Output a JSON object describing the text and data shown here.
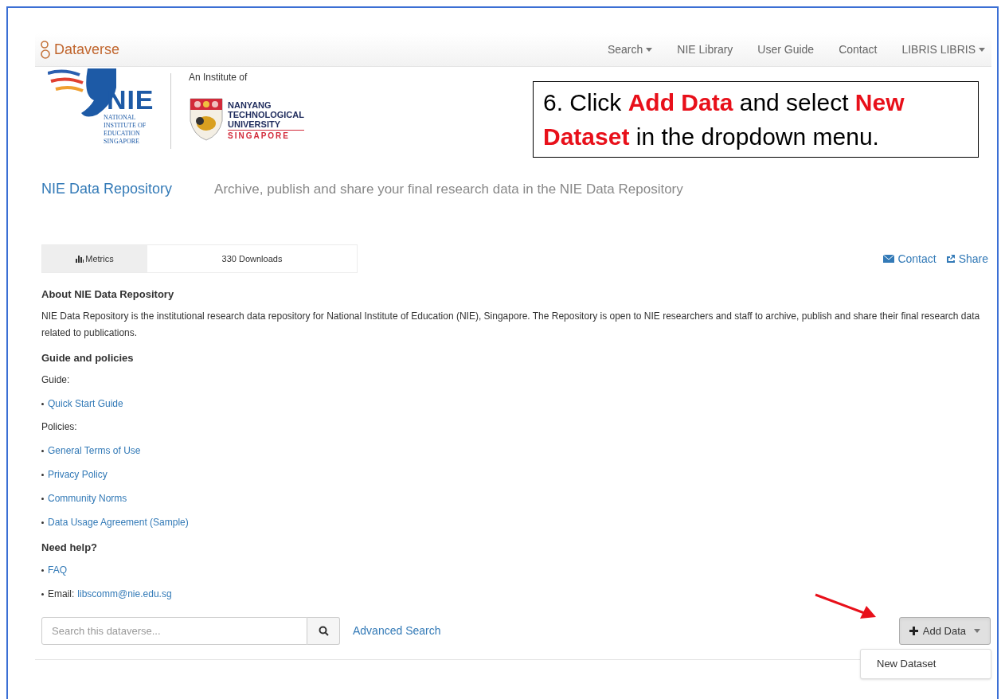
{
  "navbar": {
    "brand": "Dataverse",
    "items": [
      {
        "label": "Search",
        "dropdown": true
      },
      {
        "label": "NIE Library",
        "dropdown": false
      },
      {
        "label": "User Guide",
        "dropdown": false
      },
      {
        "label": "Contact",
        "dropdown": false
      },
      {
        "label": "LIBRIS LIBRIS",
        "dropdown": true
      }
    ]
  },
  "header": {
    "nie_logo": {
      "name": "NIE",
      "sub": [
        "NATIONAL",
        "INSTITUTE OF",
        "EDUCATION",
        "SINGAPORE"
      ]
    },
    "institute_of": "An Institute of",
    "ntu_logo": {
      "lines": [
        "NANYANG",
        "TECHNOLOGICAL",
        "UNIVERSITY"
      ],
      "country": "SINGAPORE"
    }
  },
  "callout": "6. Click **Add Data** and select **New Dataset** in the dropdown menu.",
  "dataverse": {
    "name": "NIE Data Repository",
    "tagline": "Archive, publish and share your final research data in the NIE Data Repository"
  },
  "metrics": {
    "label": "Metrics",
    "downloads": "330 Downloads"
  },
  "actions": [
    {
      "label": "Contact",
      "kind": "contact"
    },
    {
      "label": "Share",
      "kind": "share"
    }
  ],
  "about": [
    {
      "kind": "heading",
      "text": "About NIE Data Repository"
    },
    {
      "kind": "para",
      "text": "NIE Data Repository is the institutional research data repository for National Institute of Education (NIE), Singapore. The Repository is open to NIE researchers and staff to archive, publish and share their final research data related to publications."
    },
    {
      "kind": "heading",
      "text": "Guide and policies"
    },
    {
      "kind": "para",
      "text": "Guide:"
    },
    {
      "kind": "link",
      "text": "Quick Start Guide"
    },
    {
      "kind": "para",
      "text": "Policies:"
    },
    {
      "kind": "link",
      "text": "General Terms of Use"
    },
    {
      "kind": "link",
      "text": "Privacy Policy"
    },
    {
      "kind": "link",
      "text": "Community Norms"
    },
    {
      "kind": "link",
      "text": "Data Usage Agreement (Sample)"
    },
    {
      "kind": "heading",
      "text": "Need help?"
    },
    {
      "kind": "link",
      "text": "FAQ"
    },
    {
      "kind": "email",
      "label": "Email:",
      "text": "libscomm@nie.edu.sg"
    }
  ],
  "search": {
    "placeholder": "Search this dataverse...",
    "advanced": "Advanced Search"
  },
  "add_data": {
    "label": "Add Data",
    "expanded": true,
    "menu": [
      "New Dataset"
    ]
  }
}
